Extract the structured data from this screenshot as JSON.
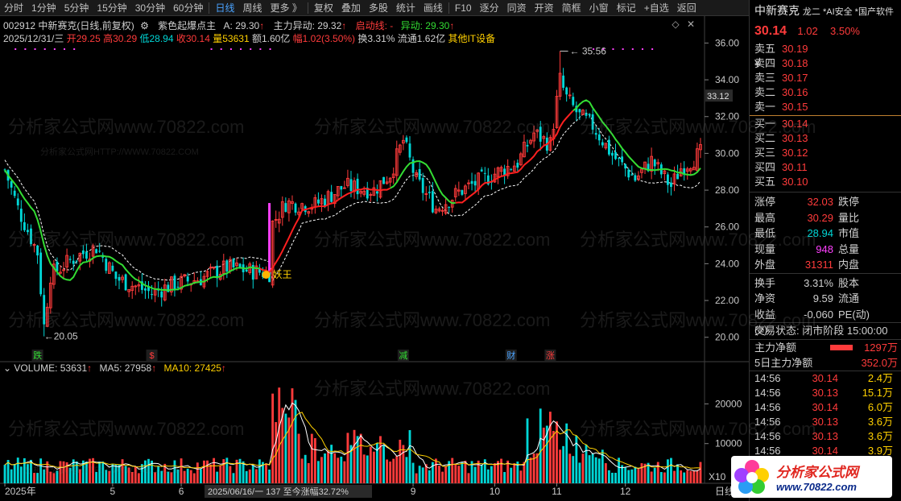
{
  "toolbar": {
    "items": [
      "分时",
      "1分钟",
      "5分钟",
      "15分钟",
      "30分钟",
      "60分钟",
      "日线",
      "周线",
      "更多 》",
      "复权",
      "叠加",
      "多股",
      "统计",
      "画线",
      "F10",
      "逐分",
      "同资",
      "开资",
      "简框",
      "小窗",
      "标记",
      "+自选",
      "返回"
    ],
    "active": "日线"
  },
  "head": {
    "code": "002912 中新赛克(日线,前复权)",
    "ind_name": "紫色起爆点主",
    "ind_a": "A: 29.30",
    "zhuli": "主力异动: 29.32",
    "qidong": "启动线: -",
    "yidong": "异动: 29.30",
    "date": "2025/12/31/三",
    "open": "开29.25",
    "high": "高30.29",
    "low": "低28.94",
    "close": "收30.14",
    "vol": "量53631",
    "amount": "额1.60亿",
    "amp": "幅1.02(3.50%)",
    "turn": "换3.31%",
    "float": "流通1.62亿",
    "sector": "其他IT设备"
  },
  "colors": {
    "up": "#ff3b3b",
    "down": "#00d7d7",
    "ma_red": "#ff2020",
    "ma_green": "#33dd33",
    "ma_white": "#ffffff",
    "ma5": "#ffffff",
    "ma10": "#ffd000",
    "magenta": "#ff40ff"
  },
  "chart_data": [
    {
      "type": "candlestick",
      "title": "002912 中新赛克(日线,前复权)",
      "y_ticks": [
        "36.00",
        "34.00",
        "32.00",
        "30.00",
        "28.00",
        "26.00",
        "24.00",
        "22.00",
        "20.00"
      ],
      "ylim": [
        19.2,
        36.5
      ],
      "x_labels": [
        {
          "label": "2025年",
          "idx": 0
        },
        {
          "label": "5",
          "idx": 33
        },
        {
          "label": "6",
          "idx": 54
        },
        {
          "label": "9",
          "idx": 125
        },
        {
          "label": "10",
          "idx": 150
        },
        {
          "label": "11",
          "idx": 169
        },
        {
          "label": "12",
          "idx": 190
        }
      ],
      "current_price_tag": "33.12",
      "annotations": {
        "max_label": "35.56",
        "min_label": "20.05",
        "demon_label": "妖王",
        "cursor_info": "2025/06/16/一 137 至今涨幅32.72%"
      },
      "markers": [
        {
          "text": "跌",
          "idx": 10,
          "color": "#33dd33"
        },
        {
          "text": "$",
          "idx": 45,
          "color": "#ff3b3b"
        },
        {
          "text": "减",
          "idx": 122,
          "color": "#33dd33"
        },
        {
          "text": "财",
          "idx": 155,
          "color": "#4aa3ff"
        },
        {
          "text": "涨",
          "idx": 167,
          "color": "#ff3b3b"
        }
      ]
    },
    {
      "type": "bar",
      "title": "VOLUME",
      "y_ticks": [
        "20000",
        "10000"
      ],
      "ylim": [
        0,
        28000
      ],
      "unit_label": "X10",
      "series": [
        {
          "name": "VOLUME: 53631"
        },
        {
          "name": "MA5: 27958"
        },
        {
          "name": "MA10: 27425"
        }
      ]
    }
  ],
  "right": {
    "name": "中新赛克",
    "tags": "龙二 *AI安全 *国产软件",
    "price": "30.14",
    "change": "1.02",
    "pct": "3.50%",
    "asks": [
      {
        "label": "卖五 ¥",
        "price": "30.19"
      },
      {
        "label": "卖四",
        "price": "30.18"
      },
      {
        "label": "卖三",
        "price": "30.17"
      },
      {
        "label": "卖二",
        "price": "30.16"
      },
      {
        "label": "卖一",
        "price": "30.15"
      }
    ],
    "bids": [
      {
        "label": "买一",
        "price": "30.14"
      },
      {
        "label": "买二",
        "price": "30.13"
      },
      {
        "label": "买三",
        "price": "30.12"
      },
      {
        "label": "买四",
        "price": "30.11"
      },
      {
        "label": "买五",
        "price": "30.10"
      }
    ],
    "stats": [
      {
        "l": "涨停",
        "v": "32.03",
        "c": "#ff3b3b",
        "l2": "跌停"
      },
      {
        "l": "最高",
        "v": "30.29",
        "c": "#ff3b3b",
        "l2": "量比"
      },
      {
        "l": "最低",
        "v": "28.94",
        "c": "#00d7d7",
        "l2": "市值"
      },
      {
        "l": "现量",
        "v": "948",
        "c": "#ff40ff",
        "l2": "总量"
      },
      {
        "l": "外盘",
        "v": "31311",
        "c": "#ff3b3b",
        "l2": "内盘"
      }
    ],
    "stats2": [
      {
        "l": "换手",
        "v": "3.31%",
        "c": "#d0d0d0",
        "l2": "股本"
      },
      {
        "l": "净资",
        "v": "9.59",
        "c": "#d0d0d0",
        "l2": "流通"
      },
      {
        "l": "收益(≡)",
        "v": "-0.060",
        "c": "#d0d0d0",
        "l2": "PE(动)"
      }
    ],
    "phase": "交易状态: 闭市阶段 15:00:00",
    "flows": [
      {
        "l": "主力净额",
        "v": "1297万",
        "bar": 0.4
      },
      {
        "l": "5日主力净额",
        "v": "352.0万",
        "bar": 0.0
      }
    ],
    "trades": [
      {
        "t": "14:56",
        "p": "30.14",
        "v": "2.4万"
      },
      {
        "t": "14:56",
        "p": "30.13",
        "v": "15.1万"
      },
      {
        "t": "14:56",
        "p": "30.14",
        "v": "6.0万"
      },
      {
        "t": "14:56",
        "p": "30.13",
        "v": "3.6万"
      },
      {
        "t": "14:56",
        "p": "30.13",
        "v": "3.6万"
      },
      {
        "t": "14:56",
        "p": "30.14",
        "v": "3.9万"
      }
    ]
  },
  "logo": {
    "line1": "分析家公式网",
    "line2": "www.70822.com"
  },
  "watermark": "分析家公式网www.70822.com",
  "watermark_small": "分析家公式网HTTP://WWW.70822.COM",
  "bottom": {
    "axis_label": "日线"
  }
}
